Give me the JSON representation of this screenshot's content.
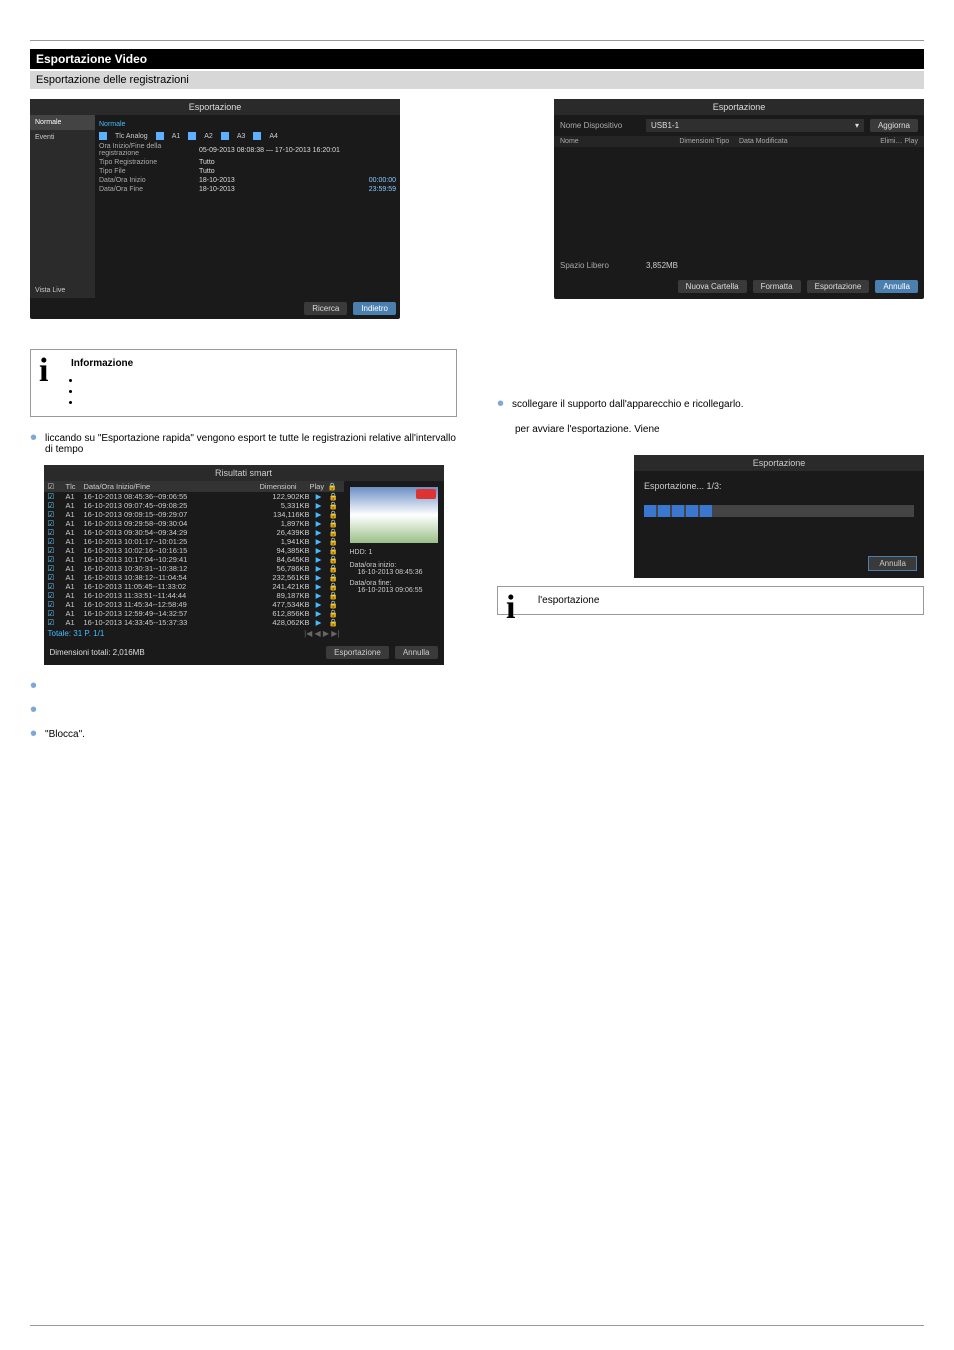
{
  "header": {
    "title": "Esportazione Video",
    "subtitle": "Esportazione delle registrazioni"
  },
  "shot1": {
    "title": "Esportazione",
    "sidebar": {
      "item1": "Normale",
      "item2": "Eventi",
      "bottom": "Vista Live"
    },
    "active_sub": "Normale",
    "chrow_label": "Tlc Analog",
    "channels": [
      "A1",
      "A2",
      "A3",
      "A4"
    ],
    "row_sched": {
      "lbl": "Ora Inizio/Fine della registrazione",
      "val": "05-09-2013 08:08:38 — 17-10-2013 16:20:01"
    },
    "row_type": {
      "lbl": "Tipo Registrazione",
      "val": "Tutto"
    },
    "row_file": {
      "lbl": "Tipo File",
      "val": "Tutto"
    },
    "row_start": {
      "lbl": "Data/Ora Inizio",
      "val": "18-10-2013",
      "time": "00:00:00"
    },
    "row_end": {
      "lbl": "Data/Ora Fine",
      "val": "18-10-2013",
      "time": "23:59:59"
    },
    "btn_search": "Ricerca",
    "btn_back": "Indietro"
  },
  "shot2": {
    "title": "Esportazione",
    "lbl_device": "Nome Dispositivo",
    "device": "USB1-1",
    "btn_agg": "Aggiorna",
    "hdr_name": "Nome",
    "hdr_dim": "Dimensioni",
    "hdr_tipo": "Tipo",
    "hdr_data": "Data Modificata",
    "hdr_eli": "Elimi…",
    "hdr_play": "Play",
    "lbl_free": "Spazio Libero",
    "free": "3,852MB",
    "btn_folder": "Nuova Cartella",
    "btn_format": "Formatta",
    "btn_export": "Esportazione",
    "btn_cancel": "Annulla"
  },
  "info1": {
    "title": "Informazione",
    "b1": "",
    "b2": "",
    "b3": ""
  },
  "left_bullets": {
    "b1": "liccando su \"Esportazione rapida\" vengono esport te tutte le registrazioni relative all'intervallo di tempo"
  },
  "right_bullets": {
    "b1": "scollegare il supporto dall'apparecchio e ricollegarlo.",
    "b2": "per avviare l'esportazione. Viene"
  },
  "smart": {
    "title": "Risultati smart",
    "h_tlc": "Tlc",
    "h_dt": "Data/Ora Inizio/Fine",
    "h_dim": "Dimensioni",
    "h_play": "Play",
    "rows": [
      {
        "ch": "A1",
        "dt": "16-10-2013 08:45:36--09:06:55",
        "sz": "122,902KB"
      },
      {
        "ch": "A1",
        "dt": "16-10-2013 09:07:45--09:08:25",
        "sz": "5,331KB"
      },
      {
        "ch": "A1",
        "dt": "16-10-2013 09:09:15--09:29:07",
        "sz": "134,116KB"
      },
      {
        "ch": "A1",
        "dt": "16-10-2013 09:29:58--09:30:04",
        "sz": "1,897KB"
      },
      {
        "ch": "A1",
        "dt": "16-10-2013 09:30:54--09:34:29",
        "sz": "26,439KB"
      },
      {
        "ch": "A1",
        "dt": "16-10-2013 10:01:17--10:01:25",
        "sz": "1,941KB"
      },
      {
        "ch": "A1",
        "dt": "16-10-2013 10:02:16--10:16:15",
        "sz": "94,385KB"
      },
      {
        "ch": "A1",
        "dt": "16-10-2013 10:17:04--10:29:41",
        "sz": "84,645KB"
      },
      {
        "ch": "A1",
        "dt": "16-10-2013 10:30:31--10:38:12",
        "sz": "56,786KB"
      },
      {
        "ch": "A1",
        "dt": "16-10-2013 10:38:12--11:04:54",
        "sz": "232,561KB"
      },
      {
        "ch": "A1",
        "dt": "16-10-2013 11:05:45--11:33:02",
        "sz": "241,421KB"
      },
      {
        "ch": "A1",
        "dt": "16-10-2013 11:33:51--11:44:44",
        "sz": "89,187KB"
      },
      {
        "ch": "A1",
        "dt": "16-10-2013 11:45:34--12:58:49",
        "sz": "477,534KB"
      },
      {
        "ch": "A1",
        "dt": "16-10-2013 12:59:49--14:32:57",
        "sz": "612,856KB"
      },
      {
        "ch": "A1",
        "dt": "16-10-2013 14:33:45--15:37:33",
        "sz": "428,062KB"
      }
    ],
    "total_page": "Totale: 31 P. 1/1",
    "hdd": "HDD: 1",
    "start_lbl": "Data/ora inizio:",
    "start_val": "16-10-2013 08:45:36",
    "end_lbl": "Data/ora fine:",
    "end_val": "16-10-2013 09:06:55",
    "dim_total": "Dimensioni totali: 2,016MB",
    "btn_export": "Esportazione",
    "btn_cancel": "Annulla"
  },
  "prog": {
    "title": "Esportazione",
    "status": "Esportazione... 1/3:",
    "btn_cancel": "Annulla"
  },
  "info2": {
    "text": "l'esportazione"
  },
  "lower_bullets": {
    "b3": "\"Blocca\"."
  },
  "footer": {
    "left": "",
    "right": ""
  }
}
